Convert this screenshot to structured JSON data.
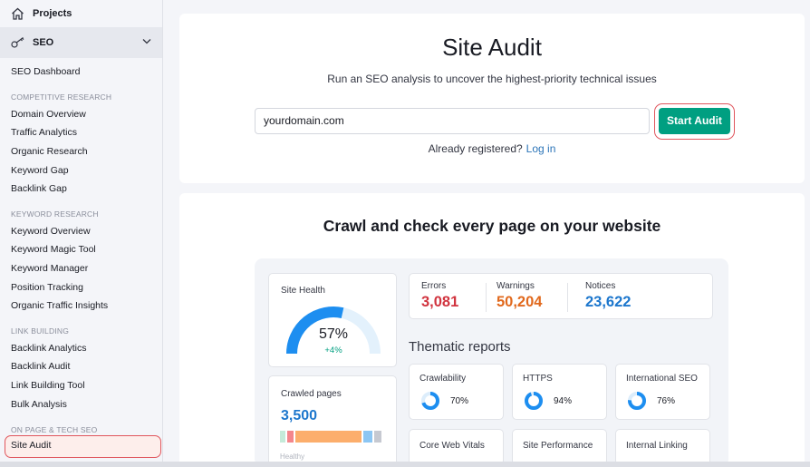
{
  "sidebar": {
    "projects_label": "Projects",
    "seo_label": "SEO",
    "dashboard": "SEO Dashboard",
    "sections": [
      {
        "title": "COMPETITIVE RESEARCH",
        "items": [
          "Domain Overview",
          "Traffic Analytics",
          "Organic Research",
          "Keyword Gap",
          "Backlink Gap"
        ]
      },
      {
        "title": "KEYWORD RESEARCH",
        "items": [
          "Keyword Overview",
          "Keyword Magic Tool",
          "Keyword Manager",
          "Position Tracking",
          "Organic Traffic Insights"
        ]
      },
      {
        "title": "LINK BUILDING",
        "items": [
          "Backlink Analytics",
          "Backlink Audit",
          "Link Building Tool",
          "Bulk Analysis"
        ]
      },
      {
        "title": "ON PAGE & TECH SEO",
        "items": [
          "Site Audit"
        ]
      }
    ]
  },
  "audit": {
    "title": "Site Audit",
    "subtitle": "Run an SEO analysis to uncover the highest-priority technical issues",
    "input_value": "yourdomain.com",
    "start_button": "Start Audit",
    "already_registered": "Already registered?",
    "login_link": "Log in"
  },
  "preview": {
    "heading": "Crawl and check every page on your website",
    "site_health_label": "Site Health",
    "site_health_value": "57%",
    "site_health_percent": 57,
    "site_health_delta": "+4%",
    "crawled_label": "Crawled pages",
    "crawled_value": "3,500",
    "crawled_legend": "Healthy",
    "stats": [
      {
        "label": "Errors",
        "value": "3,081",
        "color": "#d1343f"
      },
      {
        "label": "Warnings",
        "value": "50,204",
        "color": "#e1691d"
      },
      {
        "label": "Notices",
        "value": "23,622",
        "color": "#1d77cd"
      }
    ],
    "thematic_title": "Thematic reports",
    "thematic": [
      {
        "label": "Crawlability",
        "value": "70%",
        "percent": 70
      },
      {
        "label": "HTTPS",
        "value": "94%",
        "percent": 94
      },
      {
        "label": "International SEO",
        "value": "76%",
        "percent": 76
      }
    ],
    "thematic_more": [
      "Core Web Vitals",
      "Site Performance",
      "Internal Linking"
    ]
  },
  "colors": {
    "accent_green": "#009f81",
    "highlight_red": "#e0565d",
    "link_blue": "#2b74b8"
  }
}
